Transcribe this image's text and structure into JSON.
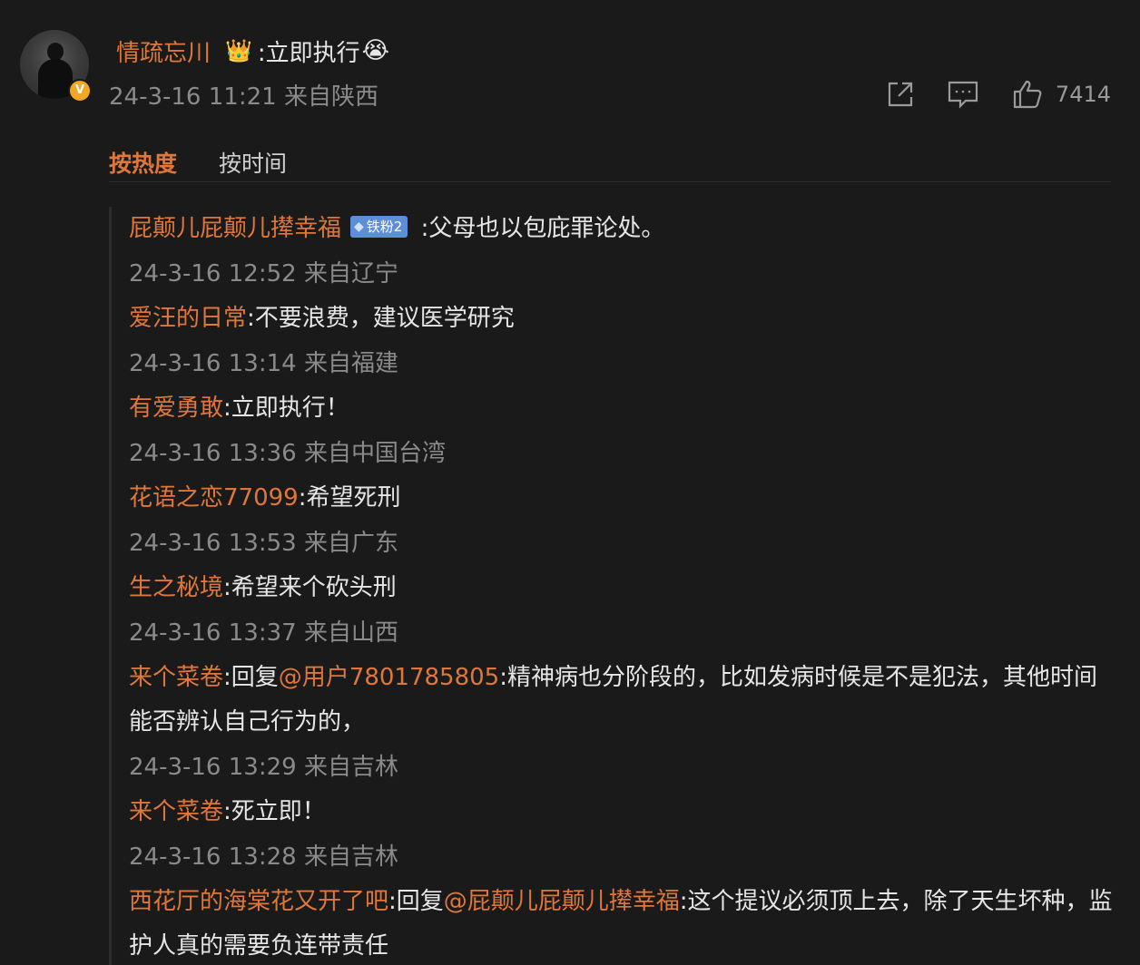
{
  "post": {
    "author": "情疏忘川",
    "text": ":立即执行",
    "crown_icon": "crown-icon",
    "emoji_icon": "crying-laughing-emoji-icon",
    "avatar_badge": "V",
    "timestamp": "24-3-16 11:21",
    "location": "来自陕西",
    "like_count": "7414"
  },
  "sort": {
    "hot_label": "按热度",
    "time_label": "按时间"
  },
  "replies": [
    {
      "user": "屁颠儿屁颠儿撵幸福",
      "badge": "铁粉2",
      "text": " :父母也以包庇罪论处。",
      "timestamp": "24-3-16 12:52",
      "location": "来自辽宁"
    },
    {
      "user": "爱汪的日常",
      "text": ":不要浪费，建议医学研究",
      "timestamp": "24-3-16 13:14",
      "location": "来自福建"
    },
    {
      "user": "有爱勇敢",
      "text": ":立即执行！",
      "timestamp": "24-3-16 13:36",
      "location": "来自中国台湾"
    },
    {
      "user": "花语之恋77099",
      "text": ":希望死刑",
      "timestamp": "24-3-16 13:53",
      "location": "来自广东"
    },
    {
      "user": "生之秘境",
      "text": ":希望来个砍头刑",
      "timestamp": "24-3-16 13:37",
      "location": "来自山西"
    },
    {
      "user": "来个菜卷",
      "reply_prefix": ":回复",
      "mention": "@用户7801785805",
      "text": ":精神病也分阶段的，比如发病时候是不是犯法，其他时间能否辨认自己行为的，",
      "timestamp": "24-3-16 13:29",
      "location": "来自吉林"
    },
    {
      "user": "来个菜卷",
      "text": ":死立即！",
      "timestamp": "24-3-16 13:28",
      "location": "来自吉林"
    },
    {
      "user": "西花厅的海棠花又开了吧",
      "reply_prefix": ":回复",
      "mention": "@屁颠儿屁颠儿撵幸福",
      "text": ":这个提议必须顶上去，除了天生坏种，监护人真的需要负连带责任"
    }
  ]
}
